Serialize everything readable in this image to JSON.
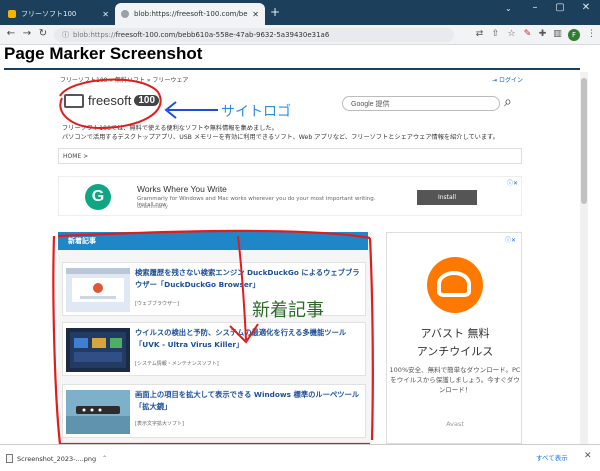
{
  "browser": {
    "tabs": [
      {
        "title": "フリーソフト100",
        "active": false
      },
      {
        "title": "blob:https://freesoft-100.com/be",
        "active": true
      }
    ],
    "url_scheme": "blob:https://",
    "url_rest": "freesoft-100.com/bebb610a-558e-47ab-9632-5a39430e31a6",
    "profile_initial": "F"
  },
  "page": {
    "heading": "Page Marker Screenshot"
  },
  "site": {
    "top_text": "フリーソフト100 » 無料ソフト » フリーウェア",
    "login": "ログイン",
    "logo_text": "freesoft",
    "logo_num": "100",
    "search_placeholder": "Google 提供",
    "tagline1": "フリーソフト100では、無料で使える便利なソフトや無料情報を集めました。",
    "tagline2": "パソコンで活用するデスクトップアプリ、USB メモリーを有効に利用できるソフト、Web アプリなど、フリーソフトとシェアウェア情報を紹介しています。",
    "breadcrumb": "HOME >",
    "ad1": {
      "logo_letter": "G",
      "title": "Works Where You Write",
      "desc": "Grammarly for Windows and Mac works wherever you do your most important writing. Install now",
      "brand": "Grammarly",
      "button": "Install"
    },
    "news": {
      "heading": "新着記事",
      "articles": [
        {
          "title": "検索履歴を残さない検索エンジン DuckDuckGo によるウェブブラウザー「DuckDuckGo Browser」",
          "category": "[ウェブブラウザー]"
        },
        {
          "title": "ウイルスの検出と予防、システムの最適化を行える多機能ツール「UVK - Ultra Virus Killer」",
          "category": "[システム情報・メンテナンスソフト]"
        },
        {
          "title": "画面上の項目を拡大して表示できる Windows 標準のルーペツール「拡大鏡」",
          "category": "[表示文字拡大ソフト]"
        }
      ]
    },
    "ad2": {
      "headline1": "アバスト 無料",
      "headline2": "アンチウイルス",
      "body": "100%安全、無料で簡単なダウンロード。PCをウイルスから保護しましょう。今すぐダウンロード！",
      "brand": "Avast"
    }
  },
  "annotations": {
    "logo_label": "サイトロゴ",
    "news_label": "新着記事",
    "color_red": "#e11c1c",
    "color_blue": "#1d4fdc"
  },
  "downloads": {
    "file": "Screenshot_2023-....png",
    "show_all": "すべて表示"
  }
}
